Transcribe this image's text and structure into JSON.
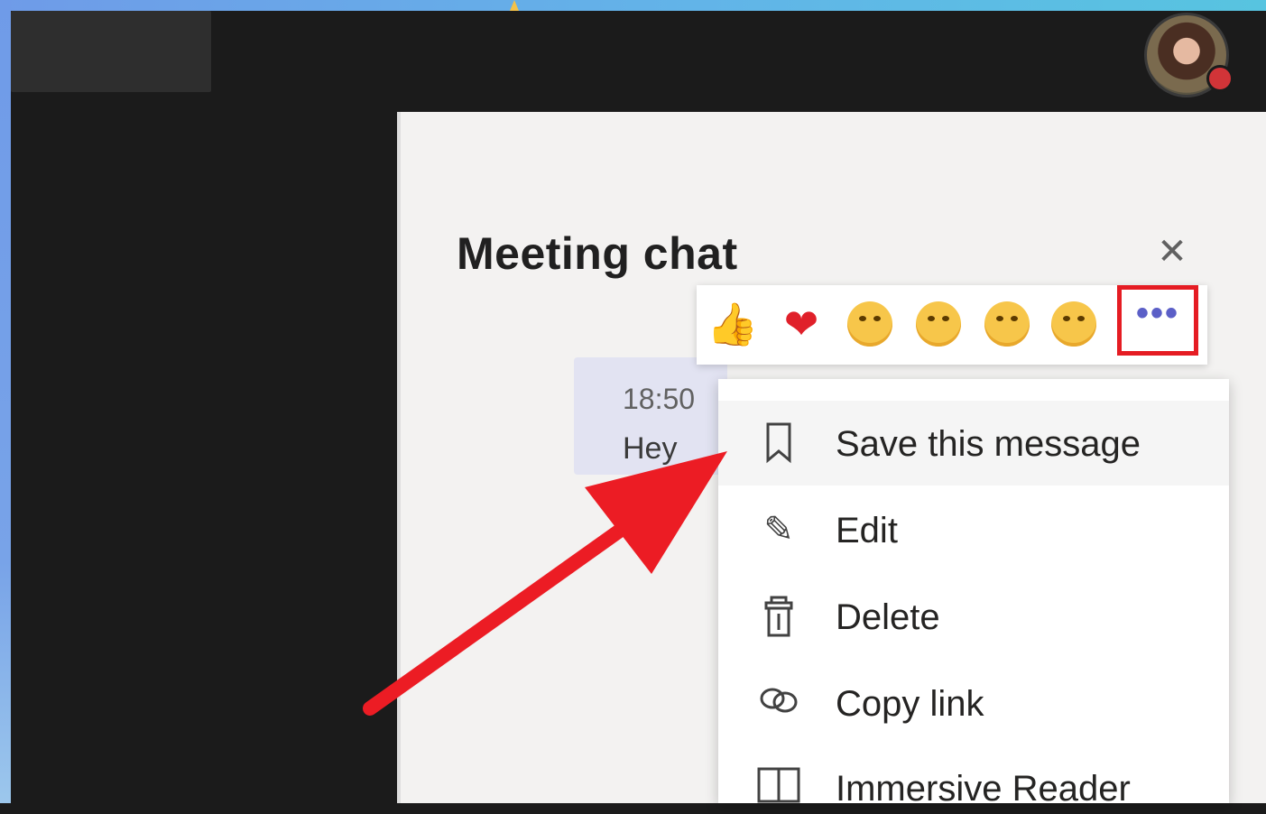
{
  "panel": {
    "title": "Meeting chat",
    "close_icon": "close-icon",
    "close_glyph": "✕"
  },
  "message": {
    "time": "18:50",
    "text": "Hey"
  },
  "reactions": {
    "items": [
      {
        "name": "like",
        "glyph": "👍"
      },
      {
        "name": "heart",
        "glyph": "❤"
      },
      {
        "name": "laugh"
      },
      {
        "name": "surprised"
      },
      {
        "name": "sad"
      },
      {
        "name": "angry"
      }
    ],
    "more_label": "•••"
  },
  "menu": {
    "items": [
      {
        "label": "Save this message",
        "icon": "bookmark-icon",
        "glyph": "⎕"
      },
      {
        "label": "Edit",
        "icon": "pencil-icon",
        "glyph": "✎"
      },
      {
        "label": "Delete",
        "icon": "trash-icon",
        "glyph": "🗑"
      },
      {
        "label": "Copy link",
        "icon": "link-icon",
        "glyph": "🔗"
      },
      {
        "label": "Immersive Reader",
        "icon": "immersive-reader-icon",
        "glyph": "📖"
      }
    ]
  },
  "colors": {
    "highlight": "#e51c23",
    "accent": "#5b5fc7",
    "presence": "#d13438"
  }
}
